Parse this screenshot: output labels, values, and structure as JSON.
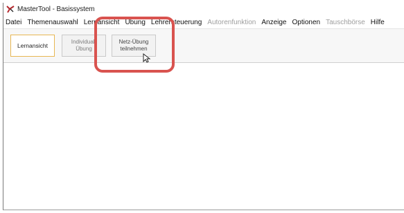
{
  "window": {
    "title": "MasterTool - Basissystem",
    "title_extra": "",
    "app_icon": "mastertool-app-icon"
  },
  "menu": {
    "items": [
      {
        "label": "Datei",
        "enabled": true
      },
      {
        "label": "Themenauswahl",
        "enabled": true
      },
      {
        "label": "Lernansicht",
        "enabled": true
      },
      {
        "label": "Übung",
        "enabled": true
      },
      {
        "label": "Lehrersteuerung",
        "enabled": true
      },
      {
        "label": "Autorenfunktion",
        "enabled": false
      },
      {
        "label": "Anzeige",
        "enabled": true
      },
      {
        "label": "Optionen",
        "enabled": true
      },
      {
        "label": "Tauschbörse",
        "enabled": false
      },
      {
        "label": "Hilfe",
        "enabled": true
      }
    ]
  },
  "toolbar": {
    "buttons": [
      {
        "label": "Lernansicht",
        "active": true
      },
      {
        "label": "Individual-\nÜbung",
        "active": false
      },
      {
        "label": "Netz-Übung\nteilnehmen",
        "active": false
      }
    ]
  },
  "colors": {
    "highlight": "#d9534f",
    "active_border": "#e7b651",
    "disabled_text": "#9e9e9e"
  },
  "icons": {
    "cursor": "mouse-pointer-icon"
  }
}
